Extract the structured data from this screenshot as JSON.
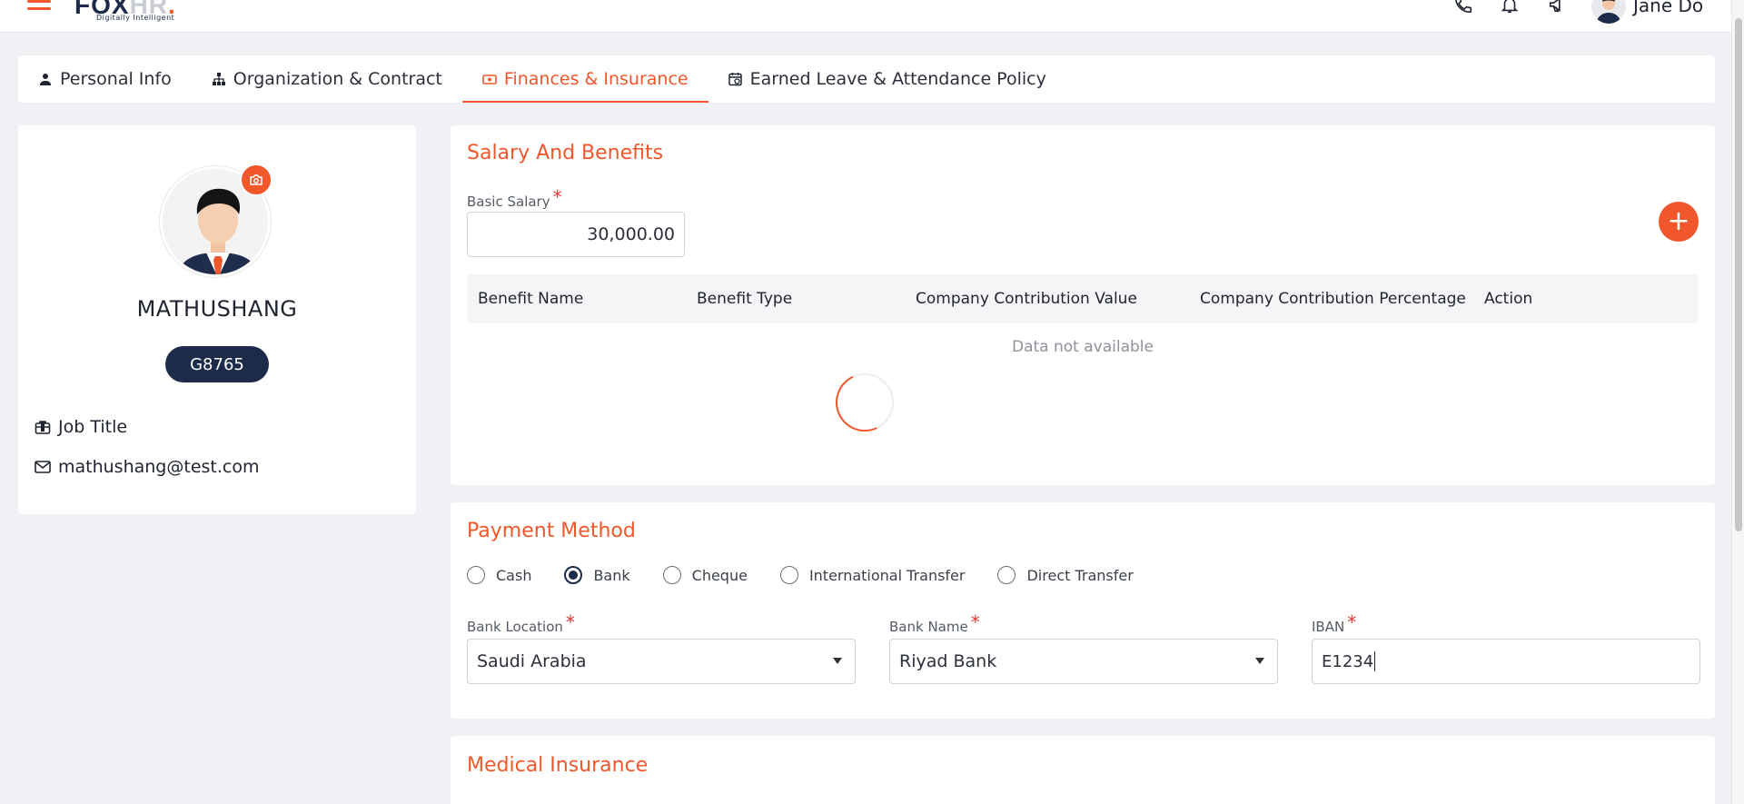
{
  "header": {
    "logo_main": "FOX",
    "logo_hr": "HR",
    "logo_dot": ".",
    "tagline": "Digitally Intelligent",
    "user_name": "Jane Do",
    "icons": [
      "menu-icon",
      "phone-icon",
      "bell-icon",
      "megaphone-icon",
      "user-avatar"
    ]
  },
  "tabs": [
    {
      "label": "Personal Info",
      "icon": "person-icon"
    },
    {
      "label": "Organization & Contract",
      "icon": "org-chart-icon"
    },
    {
      "label": "Finances & Insurance",
      "icon": "money-icon",
      "active": true
    },
    {
      "label": "Earned Leave & Attendance Policy",
      "icon": "calendar-clock-icon"
    }
  ],
  "profile": {
    "name": "MATHUSHANG",
    "employee_id": "G8765",
    "job_title": "Job Title",
    "email": "mathushang@test.com"
  },
  "salary": {
    "title": "Salary And Benefits",
    "basic_salary_label": "Basic Salary",
    "required_mark": "*",
    "basic_salary_value": "30,000.00",
    "add_label": "+",
    "columns": [
      "Benefit Name",
      "Benefit Type",
      "Company Contribution Value",
      "Company Contribution Percentage",
      "Action"
    ],
    "empty_message": "Data not available"
  },
  "payment": {
    "title": "Payment Method",
    "options": [
      "Cash",
      "Bank",
      "Cheque",
      "International Transfer",
      "Direct Transfer"
    ],
    "selected": "Bank",
    "bank_location_label": "Bank Location",
    "bank_location_value": "Saudi Arabia",
    "bank_name_label": "Bank Name",
    "bank_name_value": "Riyad Bank",
    "iban_label": "IBAN",
    "iban_value": "E1234"
  },
  "medical": {
    "title": "Medical Insurance"
  },
  "colors": {
    "accent": "#f2572b",
    "navy": "#1c2b4a",
    "background": "#f0f1f4"
  }
}
